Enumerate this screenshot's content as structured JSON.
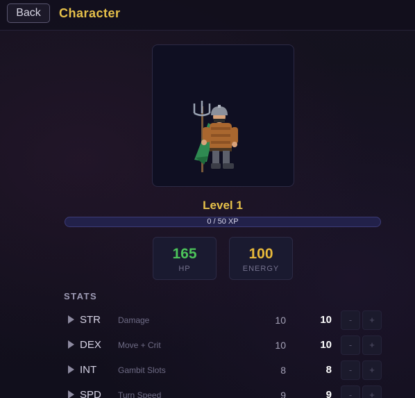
{
  "header": {
    "back_label": "Back",
    "title": "Character"
  },
  "character": {
    "level_label": "Level 1",
    "xp_text": "0 / 50 XP",
    "xp_progress": 0,
    "hp": {
      "value": "165",
      "label": "HP"
    },
    "energy": {
      "value": "100",
      "label": "ENERGY"
    }
  },
  "stats": {
    "section_title": "STATS",
    "rows": [
      {
        "abbr": "STR",
        "desc": "Damage",
        "base": "10",
        "current": "10",
        "minus": "-",
        "plus": "+"
      },
      {
        "abbr": "DEX",
        "desc": "Move + Crit",
        "base": "10",
        "current": "10",
        "minus": "-",
        "plus": "+"
      },
      {
        "abbr": "INT",
        "desc": "Gambit Slots",
        "base": "8",
        "current": "8",
        "minus": "-",
        "plus": "+"
      },
      {
        "abbr": "SPD",
        "desc": "Turn Speed",
        "base": "9",
        "current": "9",
        "minus": "-",
        "plus": "+"
      }
    ]
  },
  "colors": {
    "accent_gold": "#e7c14a",
    "hp_green": "#4cc45a",
    "energy_gold": "#e8b93a",
    "xp_bar": "#22214a"
  },
  "icons": {
    "back": "back-button",
    "expand": "triangle-right-icon",
    "portrait": "warrior-sprite-with-trident"
  }
}
